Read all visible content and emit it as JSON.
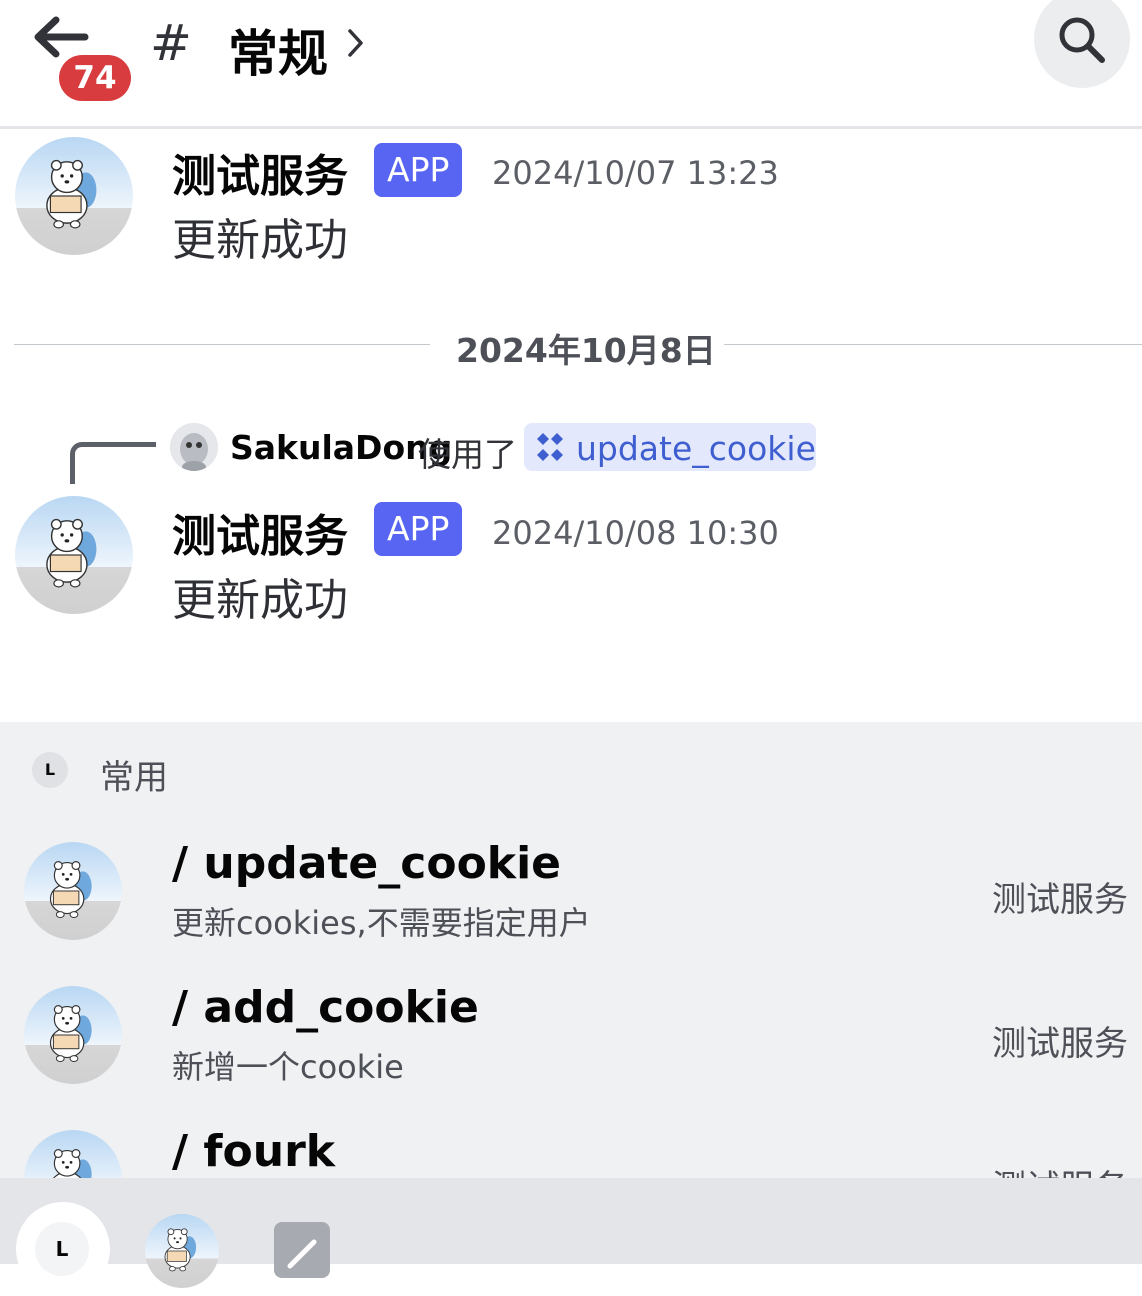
{
  "header": {
    "back_icon": "arrow-left-icon",
    "unread_badge": "74",
    "channel_symbol": "#",
    "channel_name": "常规",
    "chevron_icon": "chevron-right-icon",
    "search_icon": "search-icon"
  },
  "messages": [
    {
      "author": "测试服务",
      "badge": "APP",
      "time": "2024/10/07 13:23",
      "text": "更新成功"
    },
    {
      "author": "测试服务",
      "badge": "APP",
      "time": "2024/10/08 10:30",
      "text": "更新成功"
    }
  ],
  "date_divider": "2024年10月8日",
  "reply": {
    "user": "SakulaDong",
    "action": "使用了",
    "command": "update_cookie"
  },
  "command_panel": {
    "section_icon_letter": "L",
    "section_title": "常用",
    "commands": [
      {
        "name": "/ update_cookie",
        "description": "更新cookies,不需要指定用户",
        "app": "测试服务"
      },
      {
        "name": "/ add_cookie",
        "description": "新增一个cookie",
        "app": "测试服务"
      },
      {
        "name": "/ fourk",
        "description": "",
        "app": "测试服务"
      }
    ]
  },
  "bottom_tabs": {
    "selected_letter": "L"
  },
  "colors": {
    "accent": "#5865f2",
    "badge_red": "#d83c3e",
    "command_chip": "#e3e8fd",
    "command_link": "#3f5ecf"
  }
}
